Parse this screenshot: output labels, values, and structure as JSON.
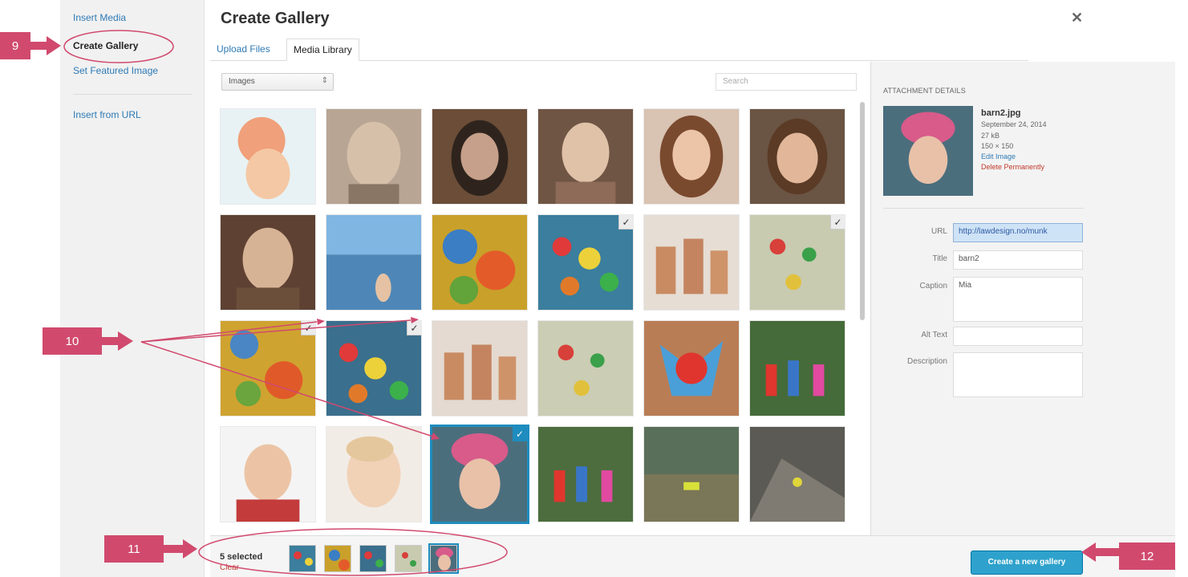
{
  "colors": {
    "accent": "#2ea2cc",
    "annotation": "#d14a6e",
    "danger": "#c0392b",
    "link": "#2e7ab5"
  },
  "sidebar": {
    "items": [
      {
        "label": "Insert Media",
        "active": false
      },
      {
        "label": "Create Gallery",
        "active": true
      },
      {
        "label": "Set Featured Image",
        "active": false
      },
      {
        "label": "Insert from URL",
        "active": false
      }
    ]
  },
  "header": {
    "title": "Create Gallery",
    "close_icon": "close-icon"
  },
  "tabs": [
    {
      "label": "Upload Files",
      "active": false
    },
    {
      "label": "Media Library",
      "active": true
    }
  ],
  "toolbar": {
    "filter_value": "Images",
    "search_placeholder": "Search"
  },
  "attachment": {
    "heading": "Attachment Details",
    "filename": "barn2.jpg",
    "date": "September 24, 2014",
    "size": "27 kB",
    "dimensions": "150 × 150",
    "edit_link": "Edit Image",
    "delete_link": "Delete Permanently",
    "fields": {
      "url_label": "URL",
      "url_value": "http://lawdesign.no/munk",
      "title_label": "Title",
      "title_value": "barn2",
      "caption_label": "Caption",
      "caption_value": "Mia",
      "alt_label": "Alt Text",
      "alt_value": "",
      "description_label": "Description",
      "description_value": ""
    }
  },
  "selection": {
    "count_label": "5 selected",
    "clear_label": "Clear"
  },
  "actions": {
    "create_gallery_label": "Create a new gallery"
  },
  "callouts": [
    "9",
    "10",
    "11",
    "12"
  ]
}
